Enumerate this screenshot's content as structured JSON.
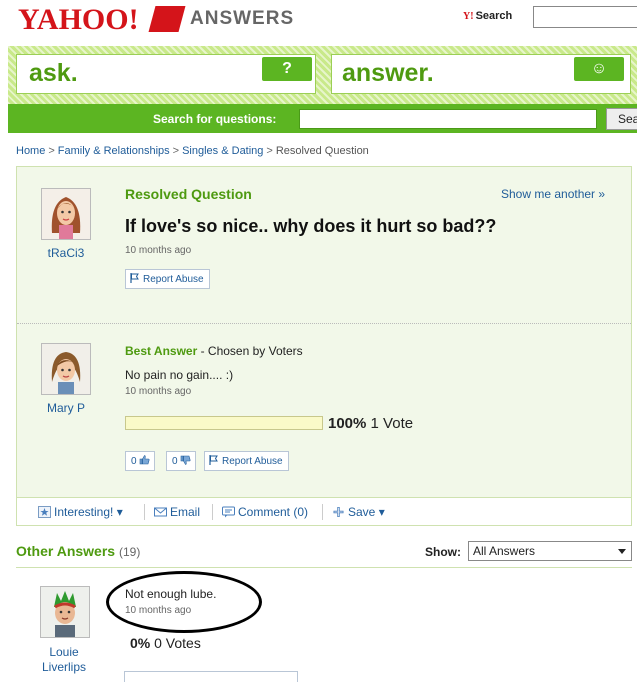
{
  "header": {
    "logo_text": "YAHOO!",
    "logo_product": "ANSWERS",
    "search_label": "Search",
    "yahoo_mark": "Y!"
  },
  "hero": {
    "ask_label": "ask.",
    "ask_icon_glyph": "?",
    "answer_label": "answer.",
    "answer_icon_glyph": "☺"
  },
  "search": {
    "label": "Search for questions:",
    "button_label": "Search"
  },
  "breadcrumb": {
    "items": [
      "Home",
      "Family & Relationships",
      "Singles & Dating"
    ],
    "current": "Resolved Question",
    "separator": ">"
  },
  "question": {
    "status": "Resolved Question",
    "show_another": "Show me another »",
    "title": "If love's so nice.. why does it hurt so bad??",
    "asker": "tRaCi3",
    "time": "10 months ago",
    "report_label": "Report Abuse"
  },
  "best_answer": {
    "label": "Best Answer",
    "chosen_by": " - Chosen by Voters",
    "answerer": "Mary P",
    "text": "No pain no gain.... :)",
    "time": "10 months ago",
    "vote_percent": "100%",
    "vote_fraction": 1.0,
    "vote_count": "1 Vote",
    "thumbs_up": "0",
    "thumbs_down": "0",
    "report_label": "Report Abuse"
  },
  "actions": {
    "interesting": "Interesting!",
    "email": "Email",
    "comment": "Comment (0)",
    "save": "Save"
  },
  "other_answers": {
    "title": "Other Answers",
    "count": "(19)",
    "show_label": "Show:",
    "show_selected": "All Answers",
    "items": [
      {
        "answerer": "Louie Liverlips",
        "text": "Not enough lube.",
        "time": "10 months ago",
        "vote_percent": "0%",
        "vote_count": "0 Votes"
      }
    ]
  },
  "colors": {
    "brand_red": "#d4141a",
    "brand_green": "#5cb522",
    "link_blue": "#1f5c99"
  }
}
